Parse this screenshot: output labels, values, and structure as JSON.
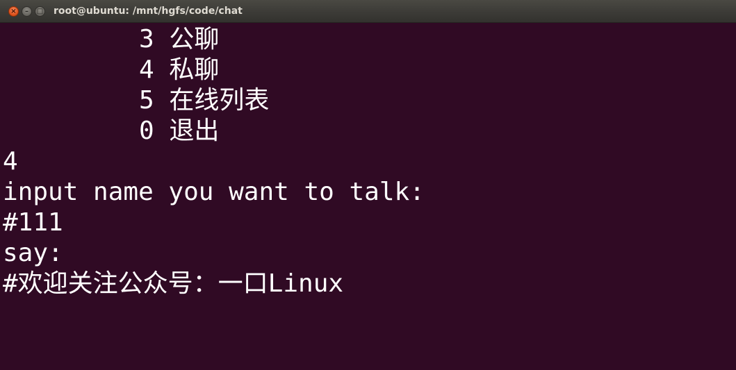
{
  "window": {
    "title": "root@ubuntu: /mnt/hgfs/code/chat",
    "controls": {
      "close_glyph": "×",
      "minimize_glyph": "–",
      "maximize_glyph": "□"
    }
  },
  "terminal": {
    "colors": {
      "background": "#300a24",
      "foreground": "#ffffff"
    },
    "lines": [
      "3 公聊",
      "4 私聊",
      "5 在线列表",
      "0 退出",
      "4",
      "input name you want to talk:",
      "#111",
      "say:",
      "#欢迎关注公众号：一口Linux"
    ]
  }
}
